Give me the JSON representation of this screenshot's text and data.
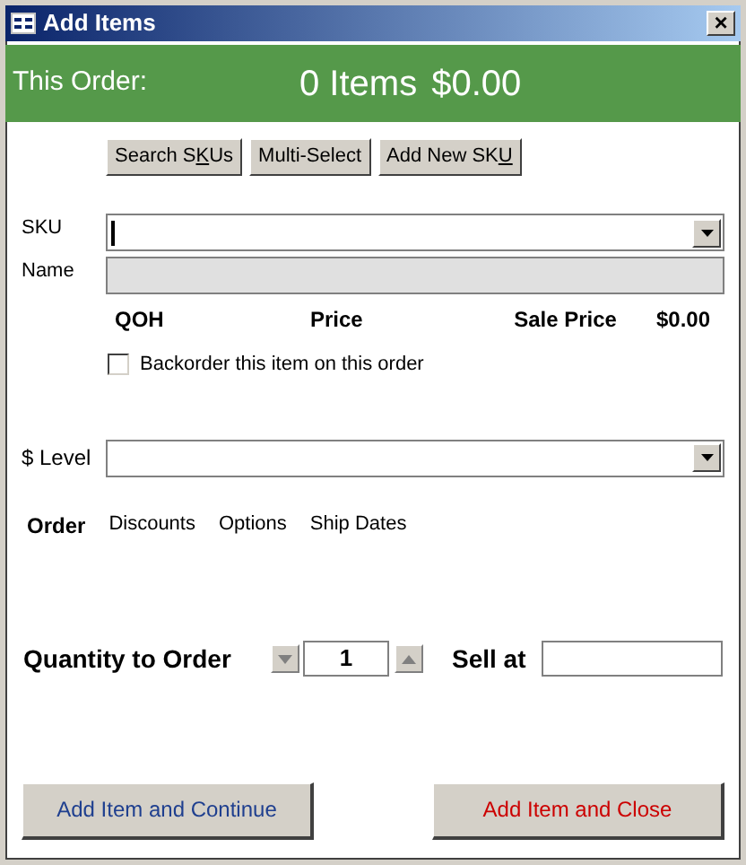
{
  "window": {
    "title": "Add Items",
    "close": "×"
  },
  "summary": {
    "label": "This Order:",
    "items": "0 Items",
    "total": "$0.00"
  },
  "tool_buttons": [
    {
      "before": "Search S",
      "key": "K",
      "after": "Us"
    },
    {
      "before": "Multi-Select"
    },
    {
      "before": "Add New SK",
      "key": "U"
    }
  ],
  "sku": {
    "label": "SKU"
  },
  "name": {
    "label": "Name",
    "disabled": true
  },
  "price_row": {
    "qoh": "QOH",
    "price": "Price",
    "sale_price_label": "Sale Price",
    "sale_price": "$0.00"
  },
  "backorder": {
    "label": "Backorder this item on this order",
    "checked": false
  },
  "level": {
    "label": "$ Level"
  },
  "tabs": [
    {
      "label": "Order",
      "selected": true
    },
    {
      "label": "Discounts",
      "selected": false
    },
    {
      "label": "Options",
      "selected": false
    },
    {
      "label": "Ship Dates",
      "selected": false
    }
  ],
  "quantity": {
    "label": "Quantity to Order",
    "value": "1"
  },
  "sell_at": {
    "label": "Sell at"
  },
  "actions": [
    {
      "label": "Add Item and Continue",
      "kind": "continue"
    },
    {
      "label": "Add Item and Close",
      "kind": "close"
    }
  ]
}
